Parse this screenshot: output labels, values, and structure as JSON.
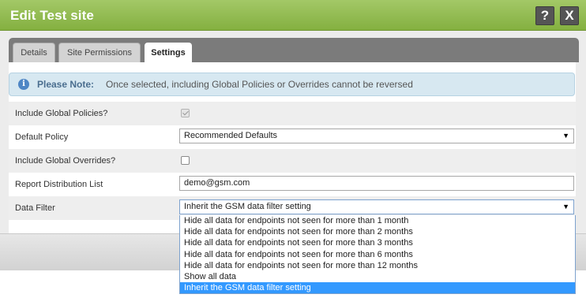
{
  "dialog": {
    "title": "Edit Test site",
    "help_label": "?",
    "close_label": "X"
  },
  "tabs": [
    {
      "label": "Details",
      "active": false
    },
    {
      "label": "Site Permissions",
      "active": false
    },
    {
      "label": "Settings",
      "active": true
    }
  ],
  "note": {
    "icon": "info-icon",
    "icon_glyph": "i",
    "label": "Please Note:",
    "text": "Once selected, including Global Policies or Overrides cannot be reversed"
  },
  "fields": {
    "include_global_policies": {
      "label": "Include Global Policies?",
      "checked": true,
      "disabled": true
    },
    "default_policy": {
      "label": "Default Policy",
      "value": "Recommended Defaults"
    },
    "include_global_overrides": {
      "label": "Include Global Overrides?",
      "checked": false
    },
    "report_distribution_list": {
      "label": "Report Distribution List",
      "value": "demo@gsm.com"
    },
    "data_filter": {
      "label": "Data Filter",
      "value": "Inherit the GSM data filter setting",
      "options": [
        "Hide all data for endpoints not seen for more than 1 month",
        "Hide all data for endpoints not seen for more than 2 months",
        "Hide all data for endpoints not seen for more than 3 months",
        "Hide all data for endpoints not seen for more than 6 months",
        "Hide all data for endpoints not seen for more than 12 months",
        "Show all data",
        "Inherit the GSM data filter setting"
      ],
      "selected_index": 6
    }
  },
  "dropdown_arrow": "▼",
  "colors": {
    "titlebar": "#94bc53",
    "selection": "#3399ff",
    "note_bg": "#d7e8f1"
  }
}
